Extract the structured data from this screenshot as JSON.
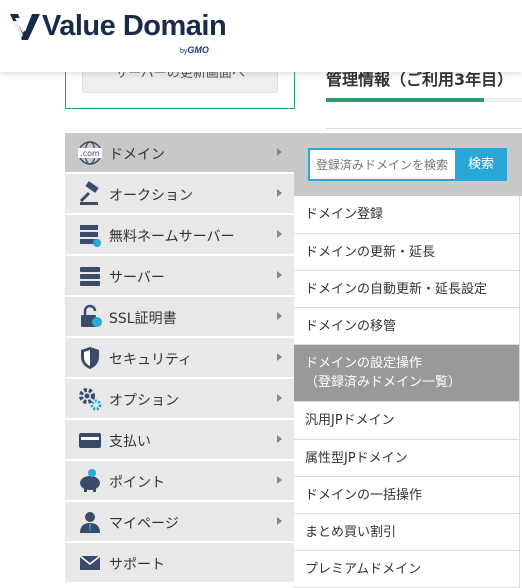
{
  "brand": {
    "name": "Value Domain",
    "by": "by",
    "gmo": "GMO"
  },
  "background": {
    "button_label": "サーバーの更新画面へ",
    "title": "管理情報（ご利用3年目）"
  },
  "menu": [
    {
      "label": "ドメイン",
      "icon": "domain-com-icon"
    },
    {
      "label": "オークション",
      "icon": "auction-gavel-icon"
    },
    {
      "label": "無料ネームサーバー",
      "icon": "nameserver-icon"
    },
    {
      "label": "サーバー",
      "icon": "server-icon"
    },
    {
      "label": "SSL証明書",
      "icon": "ssl-lock-icon"
    },
    {
      "label": "セキュリティ",
      "icon": "security-shield-icon"
    },
    {
      "label": "オプション",
      "icon": "option-gear-icon"
    },
    {
      "label": "支払い",
      "icon": "payment-card-icon"
    },
    {
      "label": "ポイント",
      "icon": "point-piggybank-icon"
    },
    {
      "label": "マイページ",
      "icon": "mypage-user-icon"
    },
    {
      "label": "サポート",
      "icon": "support-mail-icon"
    }
  ],
  "submenu": {
    "search_placeholder": "登録済みドメインを検索",
    "search_button": "検索",
    "items": [
      {
        "label": "ドメイン登録"
      },
      {
        "label": "ドメインの更新・延長"
      },
      {
        "label": "ドメインの自動更新・延長設定"
      },
      {
        "label": "ドメインの移管"
      },
      {
        "label": "ドメインの設定操作",
        "label2": "（登録済みドメイン一覧）"
      },
      {
        "label": "汎用JPドメイン"
      },
      {
        "label": "属性型JPドメイン"
      },
      {
        "label": "ドメインの一括操作"
      },
      {
        "label": "まとめ買い割引"
      },
      {
        "label": "プレミアムドメイン"
      }
    ]
  },
  "colors": {
    "accent": "#29a8d8",
    "brand": "#1a2a4a",
    "green": "#2e9a6a"
  }
}
